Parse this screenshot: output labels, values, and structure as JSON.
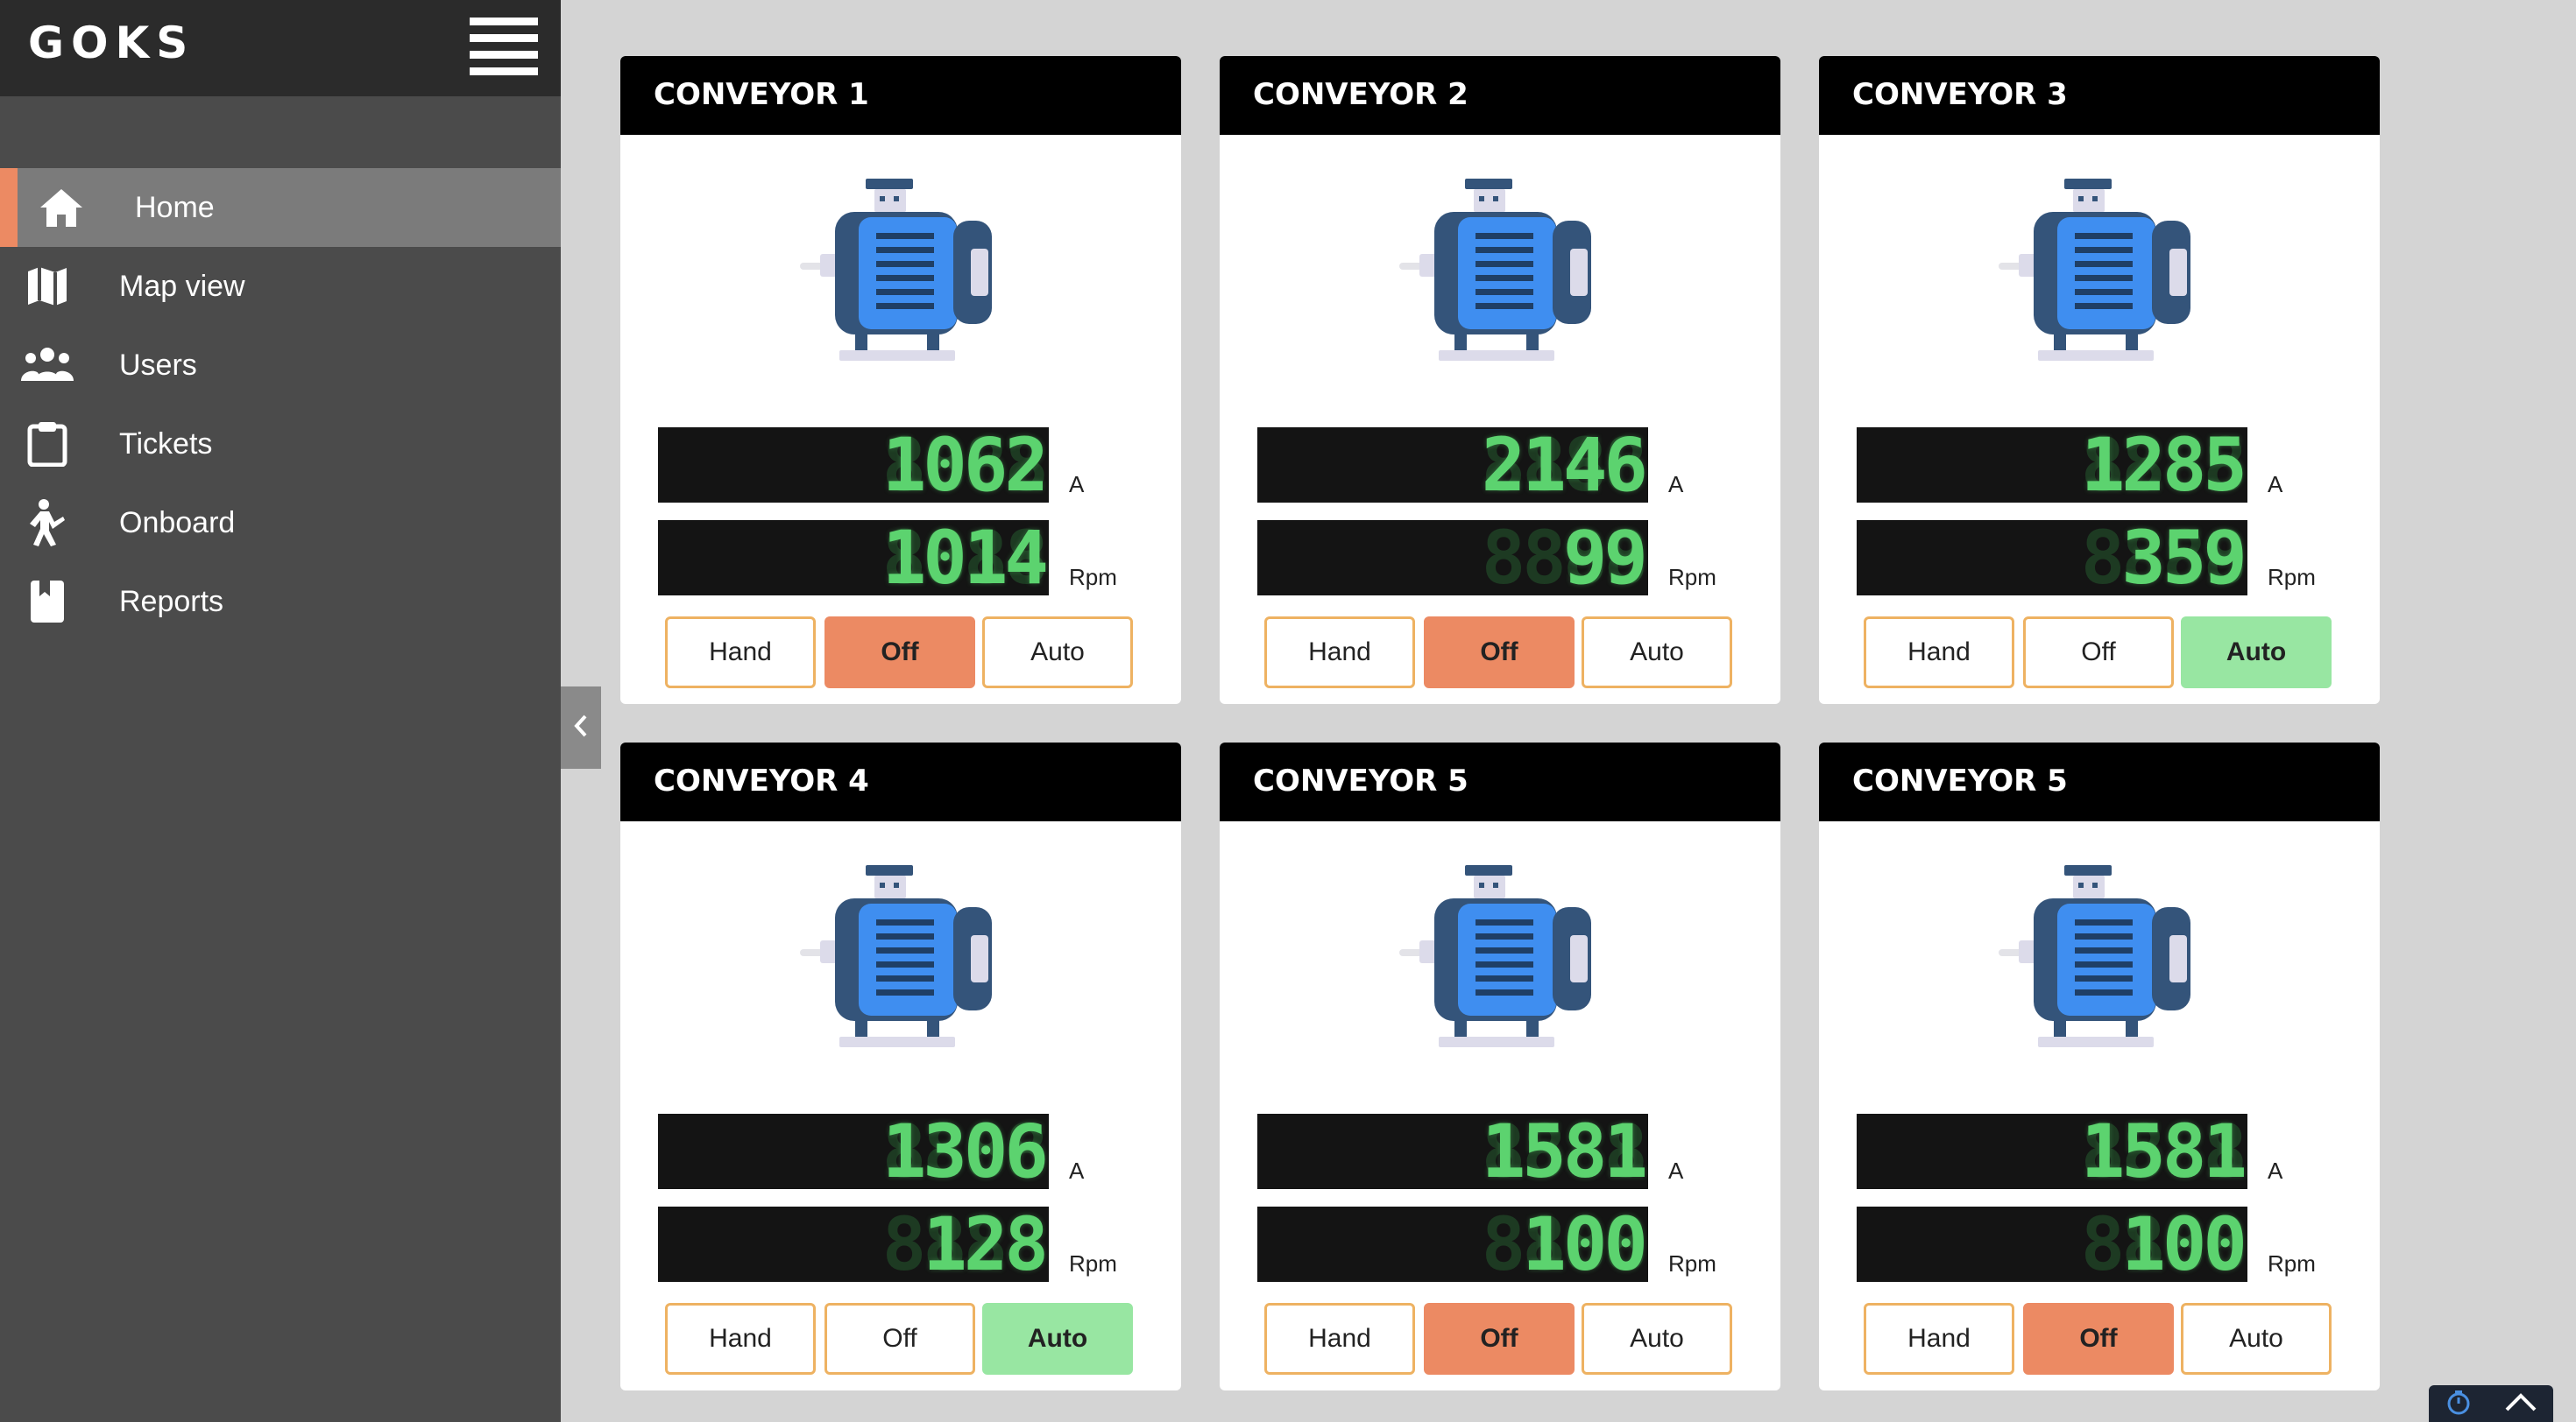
{
  "app": {
    "logo": "GOKS"
  },
  "sidebar": {
    "items": [
      {
        "label": "Home",
        "icon": "home-icon",
        "active": true
      },
      {
        "label": "Map view",
        "icon": "map-icon"
      },
      {
        "label": "Users",
        "icon": "users-icon"
      },
      {
        "label": "Tickets",
        "icon": "clipboard-icon"
      },
      {
        "label": "Onboard",
        "icon": "person-walking-icon"
      },
      {
        "label": "Reports",
        "icon": "book-icon"
      }
    ]
  },
  "colors": {
    "off_active": "#ec8a63",
    "auto_active": "#98e6a2",
    "button_border": "#eeb262",
    "display_digits": "#5cd36f"
  },
  "cards": [
    {
      "title": "CONVEYOR 1",
      "current": "1062",
      "current_unit": "A",
      "speed": "1014",
      "speed_unit": "Rpm",
      "mode": "Off",
      "buttons": [
        "Hand",
        "Off",
        "Auto"
      ]
    },
    {
      "title": "CONVEYOR 2",
      "current": "2146",
      "current_unit": "A",
      "speed": "99",
      "speed_unit": "Rpm",
      "mode": "Off",
      "buttons": [
        "Hand",
        "Off",
        "Auto"
      ]
    },
    {
      "title": "CONVEYOR 3",
      "current": "1285",
      "current_unit": "A",
      "speed": "359",
      "speed_unit": "Rpm",
      "mode": "Auto",
      "buttons": [
        "Hand",
        "Off",
        "Auto"
      ]
    },
    {
      "title": "CONVEYOR 4",
      "current": "1306",
      "current_unit": "A",
      "speed": "128",
      "speed_unit": "Rpm",
      "mode": "Auto",
      "buttons": [
        "Hand",
        "Off",
        "Auto"
      ]
    },
    {
      "title": "CONVEYOR 5",
      "current": "1581",
      "current_unit": "A",
      "speed": "100",
      "speed_unit": "Rpm",
      "mode": "Off",
      "buttons": [
        "Hand",
        "Off",
        "Auto"
      ]
    },
    {
      "title": "CONVEYOR 5",
      "current": "1581",
      "current_unit": "A",
      "speed": "100",
      "speed_unit": "Rpm",
      "mode": "Off",
      "buttons": [
        "Hand",
        "Off",
        "Auto"
      ]
    }
  ],
  "floating_widget": {
    "icons": [
      "stopwatch-icon",
      "chevron-up-icon"
    ]
  }
}
